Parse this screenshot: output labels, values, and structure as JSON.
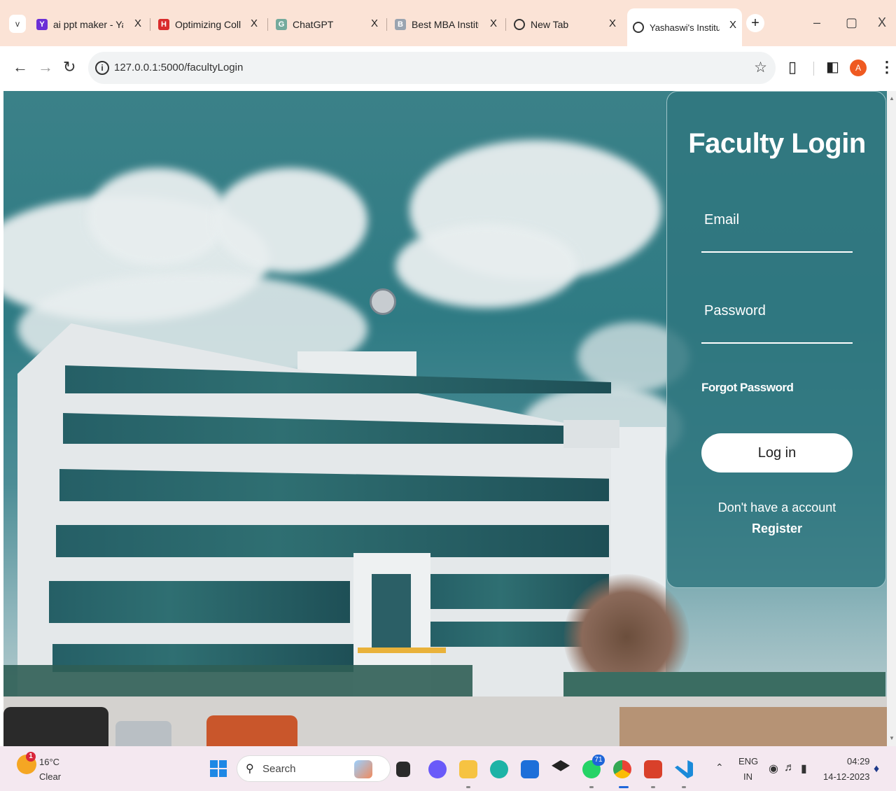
{
  "browser": {
    "tabs": [
      {
        "title": "ai ppt maker - Yah",
        "active": false,
        "favicon_color": "#6b2fd6",
        "favicon_text": "Y"
      },
      {
        "title": "Optimizing Colleg",
        "active": false,
        "favicon_color": "#d92c2c",
        "favicon_text": "H"
      },
      {
        "title": "ChatGPT",
        "active": false,
        "favicon_color": "#74aa9c",
        "favicon_text": "G"
      },
      {
        "title": "Best MBA Institut",
        "active": false,
        "favicon_color": "#9aa4b0",
        "favicon_text": "B"
      },
      {
        "title": "New Tab",
        "active": false,
        "favicon_color": "#333333",
        "favicon_text": ""
      },
      {
        "title": "Yashaswi's Institut",
        "active": true,
        "favicon_color": "#333333",
        "favicon_text": ""
      }
    ],
    "close_glyph": "X",
    "new_tab_glyph": "+",
    "tab_menu_glyph": "v",
    "window_controls": {
      "minimize": "–",
      "maximize": "▢",
      "close": "X"
    },
    "url": "127.0.0.1:5000/facultyLogin",
    "profile_initial": "A",
    "icons": [
      "back-arrow-icon",
      "forward-arrow-icon",
      "reload-icon",
      "info-icon",
      "star-icon",
      "extensions-icon",
      "side-panel-icon",
      "profile-avatar-icon",
      "more-menu-icon"
    ]
  },
  "login": {
    "title": "Faculty Login",
    "email_label": "Email",
    "password_label": "Password",
    "forgot_password": "Forgot Password",
    "login_button": "Log in",
    "no_account_text": "Don't have a account",
    "register_link": "Register"
  },
  "taskbar": {
    "weather_temp": "16°C",
    "weather_desc": "Clear",
    "weather_badge": "1",
    "search_label": "Search",
    "whatsapp_badge": "71",
    "tray_language_top": "ENG",
    "tray_language_bottom": "IN",
    "time": "04:29",
    "date": "14-12-2023"
  },
  "colors": {
    "tab_strip": "#fbe3d6",
    "card_bg": "#2f767f",
    "sky": "#3b8188"
  }
}
